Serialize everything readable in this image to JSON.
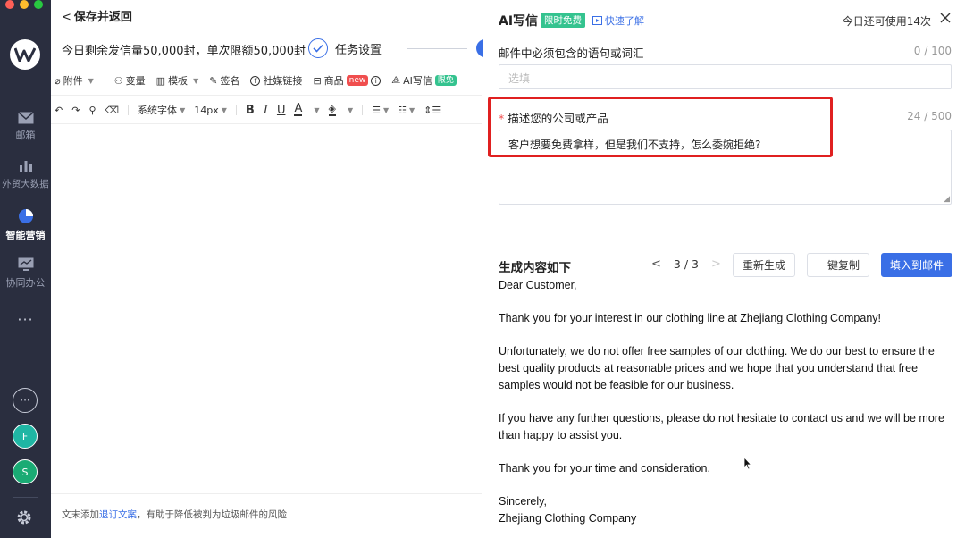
{
  "window": {
    "traffic_colors": [
      "#fe5f57",
      "#febc2e",
      "#28c840"
    ]
  },
  "sidebar": {
    "items": [
      {
        "label": "邮箱",
        "icon": "mail-icon"
      },
      {
        "label": "外贸大数据",
        "icon": "bar-chart-icon"
      },
      {
        "label": "智能营销",
        "icon": "pie-chart-icon"
      },
      {
        "label": "协同办公",
        "icon": "monitor-chart-icon"
      }
    ],
    "more": "···",
    "avatars": [
      {
        "letter": "F",
        "color": "#1fb6a4"
      },
      {
        "letter": "S",
        "color": "#1aab74"
      }
    ]
  },
  "editor": {
    "back_label": "保存并返回",
    "quota_text": "今日剩余发信量50,000封，单次限额50,000封",
    "step_label": "任务设置",
    "toolbar1": {
      "attach": "附件",
      "variable": "变量",
      "template": "模板",
      "signature": "签名",
      "social": "社媒链接",
      "product": "商品",
      "product_badge": "new",
      "ai": "AI写信",
      "ai_badge": "限免"
    },
    "toolbar2": {
      "font": "系统字体",
      "size": "14px"
    },
    "footer_prefix": "文末添加",
    "footer_link": "退订文案",
    "footer_suffix": "，有助于降低被判为垃圾邮件的风险"
  },
  "panel": {
    "title": "AI写信",
    "limited_badge": "限时免费",
    "quick_link": "快速了解",
    "usage": "今日还可使用14次",
    "field1": {
      "label": "邮件中必须包含的语句或词汇",
      "counter": "0 / 100",
      "placeholder": "选填"
    },
    "field2": {
      "required_mark": "*",
      "label": "描述您的公司或产品",
      "counter": "24 / 500",
      "value": "客户想要免费拿样，但是我们不支持，怎么委婉拒绝?"
    },
    "generated": {
      "title": "生成内容如下",
      "page": "3 / 3",
      "regen": "重新生成",
      "copy": "一键复制",
      "fill": "填入到邮件",
      "paragraphs": [
        "Dear Customer,",
        "Thank you for your interest in our clothing line at Zhejiang Clothing Company!",
        "Unfortunately, we do not offer free samples of our clothing. We do our best to ensure the best quality products at reasonable prices and we hope that you understand that free samples would not be feasible for our business.",
        "If you have any further questions, please do not hesitate to contact us and we will be more than happy to assist you.",
        "Thank you for your time and consideration."
      ],
      "closing": "Sincerely,",
      "signature": "Zhejiang Clothing Company"
    }
  }
}
